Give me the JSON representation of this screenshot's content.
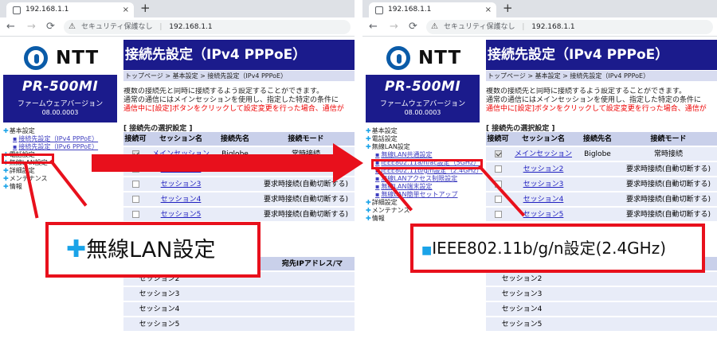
{
  "browser": {
    "tab_title": "192.168.1.1",
    "tab_close": "×",
    "new_tab": "+",
    "back": "←",
    "forward": "→",
    "reload": "C",
    "security_label": "セキュリティ保護なし",
    "separator": "|",
    "url": "192.168.1.1",
    "warning_icon": "warning-icon"
  },
  "logo": {
    "text": "NTT"
  },
  "product": {
    "name": "PR-500MI",
    "firmware_label": "ファームウェアバージョン",
    "version": "08.00.0003"
  },
  "left_panel": {
    "menu": [
      {
        "label": "基本設定",
        "sub": false
      },
      {
        "label": "接続先設定（IPv4 PPPoE）",
        "sub": true
      },
      {
        "label": "接続先設定（IPv6 PPPoE）",
        "sub": true
      },
      {
        "label": "電話設定",
        "sub": false
      },
      {
        "label": "無線LAN設定",
        "sub": false
      },
      {
        "label": "詳細設定",
        "sub": false
      },
      {
        "label": "メンテナンス",
        "sub": false
      },
      {
        "label": "情報",
        "sub": false
      }
    ],
    "callout": "無線LAN設定"
  },
  "right_panel": {
    "menu": [
      {
        "label": "基本設定",
        "sub": false
      },
      {
        "label": "電話設定",
        "sub": false
      },
      {
        "label": "無線LAN設定",
        "sub": false
      },
      {
        "label": "無線LAN共通設定",
        "sub": true
      },
      {
        "label": "IEEE802.11a/n/ac設定（5GHz）",
        "sub": true
      },
      {
        "label": "IEEE802.11b/g/n設定（2.4GHz）",
        "sub": true
      },
      {
        "label": "無線LANアクセス制限設定",
        "sub": true
      },
      {
        "label": "無線LAN端末設定",
        "sub": true
      },
      {
        "label": "無線LAN簡単セットアップ",
        "sub": true
      },
      {
        "label": "詳細設定",
        "sub": false
      },
      {
        "label": "メンテナンス",
        "sub": false
      },
      {
        "label": "情報",
        "sub": false
      }
    ],
    "callout": "IEEE802.11b/g/n設定(2.4GHz)"
  },
  "page": {
    "title": "接続先設定（IPv4 PPPoE）",
    "breadcrumb": "トップページ > 基本設定 > 接続先設定（IPv4 PPPoE）",
    "desc1": "複数の接続先と同時に接続するよう設定することができます。",
    "desc2": "通常の通信にはメインセッションを使用し、指定した特定の条件に",
    "desc3": "通信中に[設定]ボタンをクリックして設定変更を行った場合、通信が",
    "section_title": "[ 接続先の選択設定 ]",
    "headers": [
      "接続可",
      "セッション名",
      "接続先名",
      "接続モード"
    ],
    "rows": [
      {
        "checked": true,
        "session": "メインセッション",
        "dest": "Biglobe",
        "mode": "常時接続"
      },
      {
        "checked": false,
        "session": "セッション2",
        "dest": "",
        "mode": "要求時接続(自動切断する)"
      },
      {
        "checked": false,
        "session": "セッション3",
        "dest": "",
        "mode": "要求時接続(自動切断する)"
      },
      {
        "checked": false,
        "session": "セッション4",
        "dest": "",
        "mode": "要求時接続(自動切断する)"
      },
      {
        "checked": false,
        "session": "セッション5",
        "dest": "",
        "mode": "要求時接続(自動切断する)"
      }
    ],
    "table2_header": "宛先IPアドレス/マ",
    "table2_rows": [
      "セッション2",
      "セッション3",
      "セッション4",
      "セッション5"
    ]
  }
}
